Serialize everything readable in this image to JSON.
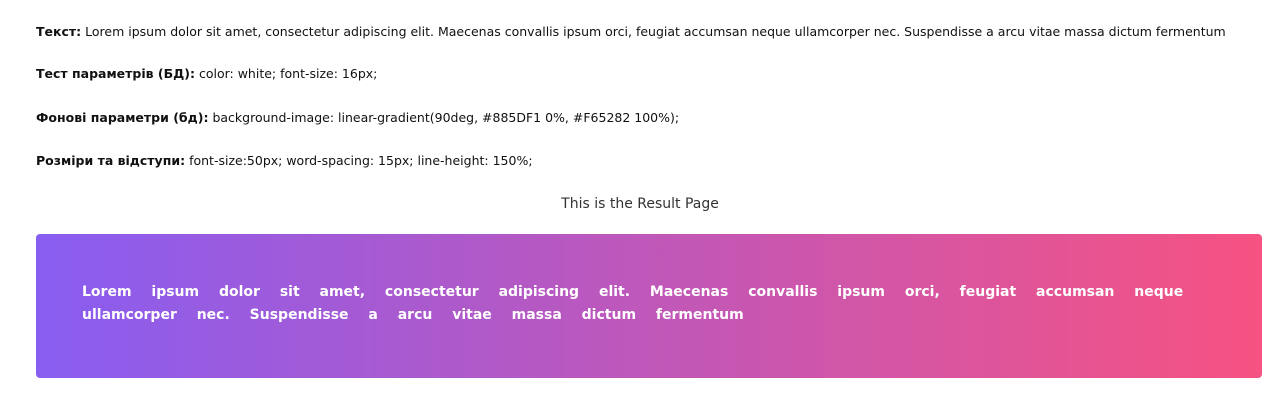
{
  "params": {
    "text_label": "Текст:",
    "text_value": "Lorem ipsum dolor sit amet, consectetur adipiscing elit. Maecenas convallis ipsum orci, feugiat accumsan neque ullamcorper nec. Suspendisse a arcu vitae massa dictum fermentum",
    "test_label": "Тест параметрів (БД):",
    "test_value": "color: white; font-size: 16px;",
    "bg_label": "Фонові параметри (бд):",
    "bg_value": "background-image: linear-gradient(90deg, #885DF1 0%, #F65282 100%);",
    "size_label": "Розміри та відступи:",
    "size_value": "font-size:50px; word-spacing: 15px; line-height: 150%;"
  },
  "result": {
    "title": "This is the Result Page",
    "text": "Lorem ipsum dolor sit amet, consectetur adipiscing elit. Maecenas convallis ipsum orci, feugiat accumsan neque ullamcorper nec. Suspendisse a arcu vitae massa dictum fermentum"
  },
  "colors": {
    "gradient_start": "#885DF1",
    "gradient_end": "#F65282",
    "result_text": "#ffffff"
  }
}
